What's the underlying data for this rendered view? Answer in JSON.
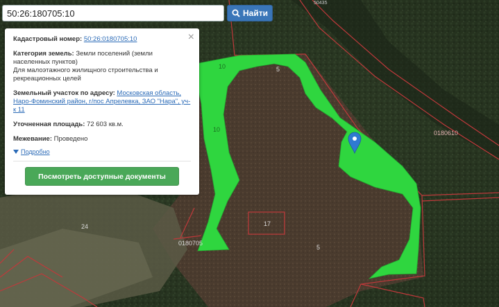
{
  "search": {
    "value": "50:26:180705:10",
    "button_label": "Найти"
  },
  "card": {
    "cadastral_label": "Кадастровый номер:",
    "cadastral_value": "50:26:0180705:10",
    "category_label": "Категория земель:",
    "category_value": "Земли поселений (земли населенных пунктов)",
    "usage_value": "Для малоэтажного жилищного строительства и рекреационных целей",
    "address_label": "Земельный участок по адресу:",
    "address_value": "Московская область, Наро-Фоминский район, г/пос Апрелевка, ЗАО \"Нара\", уч-к 11",
    "area_label": "Уточненная площадь:",
    "area_value": "72 603 кв.м.",
    "survey_label": "Межевание:",
    "survey_value": "Проведено",
    "more_label": "Подробно",
    "docs_button": "Посмотреть доступные документы",
    "close": "×"
  },
  "map_labels": {
    "parcel_10_a": "10",
    "parcel_10_b": "10",
    "parcel_5_a": "5",
    "parcel_5_b": "5",
    "parcel_17": "17",
    "parcel_24": "24",
    "block_0180610": "0180610",
    "block_0180705": "0180705",
    "block_top": "50435"
  },
  "colors": {
    "parcel_fill": "#2fd63f",
    "boundary": "#c0393b",
    "button_blue": "#3a76b8",
    "button_green": "#4aa858"
  }
}
